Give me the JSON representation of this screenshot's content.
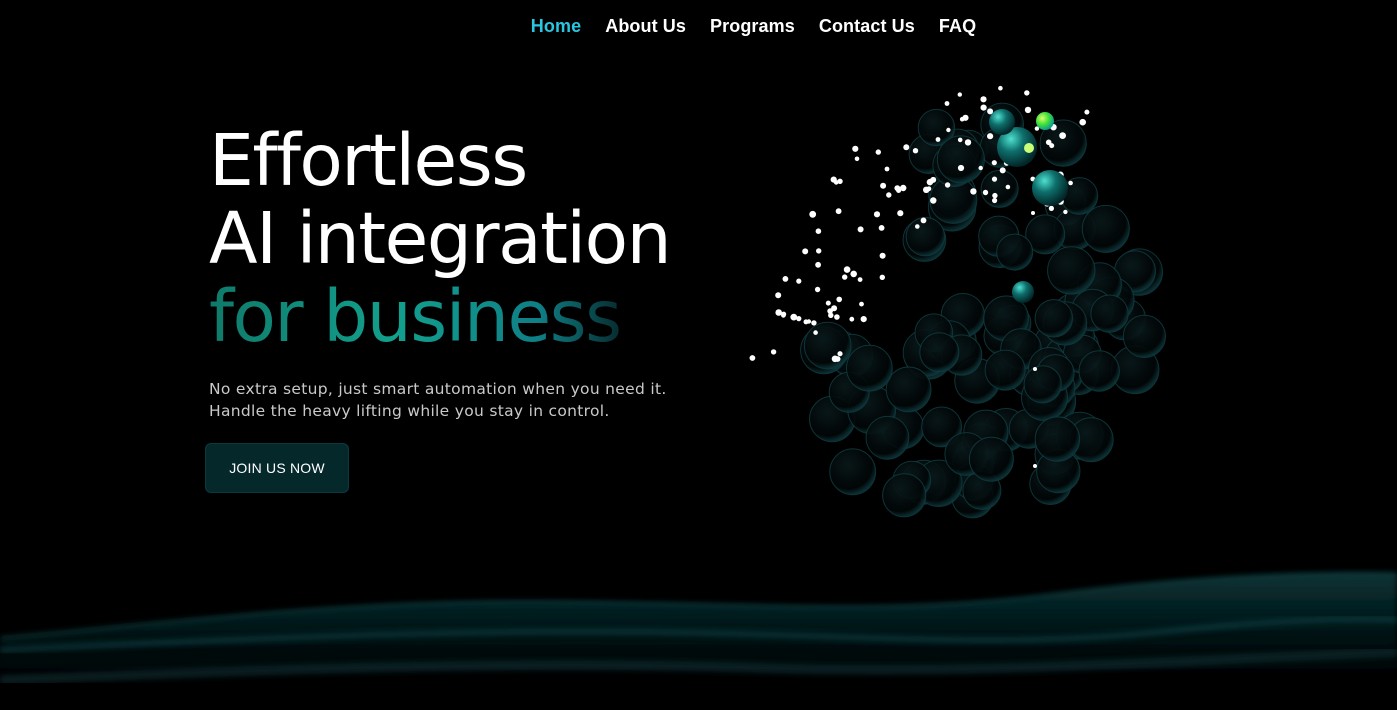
{
  "nav": {
    "items": [
      {
        "label": "Home",
        "active": true
      },
      {
        "label": "About Us",
        "active": false
      },
      {
        "label": "Programs",
        "active": false
      },
      {
        "label": "Contact Us",
        "active": false
      },
      {
        "label": "FAQ",
        "active": false
      }
    ]
  },
  "hero": {
    "line1": "Effortless",
    "line2": "AI integration",
    "line3": "for business",
    "sub_line1": "No extra setup, just smart automation when you need it.",
    "sub_line2": "Handle the heavy lifting while you stay in control.",
    "cta_label": "JOIN US NOW"
  },
  "colors": {
    "background": "#000000",
    "nav_active": "#29c6e0",
    "accent_teal": "#12a08d",
    "button_bg": "#05282b",
    "highlight_green": "#7fff3a"
  }
}
